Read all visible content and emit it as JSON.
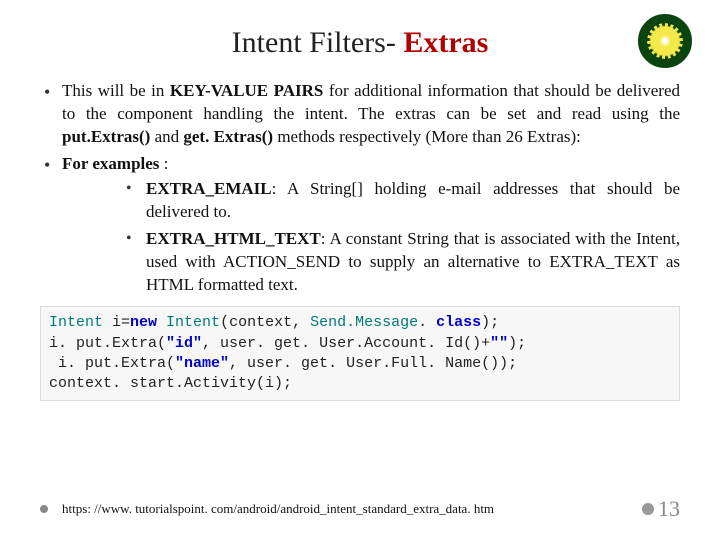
{
  "title": {
    "prefix": "Intent Filters- ",
    "highlight": "Extras"
  },
  "bullets": {
    "main": {
      "pre": "This will be in ",
      "strong1": "KEY-VALUE PAIRS",
      "mid": " for additional information that should be delivered to the component handling the intent. The extras can be set and read using the ",
      "m1": "put.Extras()",
      "mid2": " and ",
      "m2": "get. Extras()",
      "post": " methods respectively (More than 26 Extras):"
    },
    "examples_label": "For examples",
    "sub1": {
      "label": "EXTRA_EMAIL",
      "text": ": A String[] holding e-mail addresses that should be delivered to."
    },
    "sub2": {
      "label": "EXTRA_HTML_TEXT",
      "text": ": A constant String that is associated with the Intent, used with ACTION_SEND to supply an alternative to EXTRA_TEXT as HTML formatted text."
    }
  },
  "code": {
    "l1a": "Intent ",
    "l1b": "i=",
    "l1c": "new ",
    "l1d": "Intent",
    "l1e": "(context, ",
    "l1f": "Send.Message",
    "l1g": ". ",
    "l1h": "class",
    "l1i": ");",
    "l2a": "i. put.Extra(",
    "l2b": "\"id\"",
    "l2c": ", user. get. User.Account. Id()+",
    "l2d": "\"\"",
    "l2e": ");",
    "l3a": " i. put.Extra(",
    "l3b": "\"name\"",
    "l3c": ", user. get. User.Full. Name());",
    "l4": "context. start.Activity(i);"
  },
  "footer": {
    "url": "https: //www. tutorialspoint. com/android/android_intent_standard_extra_data. htm",
    "page": "13"
  }
}
